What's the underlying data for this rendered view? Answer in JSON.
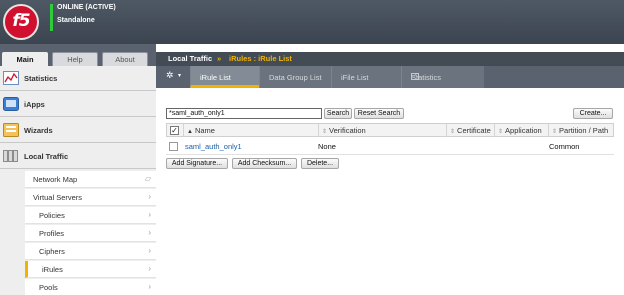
{
  "header": {
    "status_online": "ONLINE (ACTIVE)",
    "status_standalone": "Standalone",
    "logo_text": "f5"
  },
  "sidebar": {
    "tabs": [
      {
        "label": "Main",
        "active": true
      },
      {
        "label": "Help",
        "active": false
      },
      {
        "label": "About",
        "active": false
      }
    ],
    "sections": [
      {
        "label": "Statistics",
        "icon": "statistics-icon"
      },
      {
        "label": "iApps",
        "icon": "iapps-icon"
      },
      {
        "label": "Wizards",
        "icon": "wizards-icon"
      },
      {
        "label": "Local Traffic",
        "icon": "local-traffic-icon"
      }
    ],
    "local_traffic_items": [
      {
        "label": "Network Map",
        "arrow": "▱"
      },
      {
        "label": "Virtual Servers",
        "arrow": "›"
      },
      {
        "label": "Policies",
        "arrow": "›"
      },
      {
        "label": "Profiles",
        "arrow": "›"
      },
      {
        "label": "Ciphers",
        "arrow": "›"
      },
      {
        "label": "iRules",
        "arrow": "›",
        "active": true
      },
      {
        "label": "Pools",
        "arrow": "›"
      }
    ]
  },
  "content": {
    "breadcrumb_section": "Local Traffic",
    "breadcrumb_separator": "»",
    "breadcrumb_page": "iRules : iRule List",
    "subtabs": [
      {
        "label": "iRule List",
        "active": true
      },
      {
        "label": "Data Group List",
        "active": false
      },
      {
        "label": "iFile List",
        "active": false
      },
      {
        "label": "Statistics",
        "active": false
      }
    ],
    "search": {
      "value": "*saml_auth_only1",
      "search_label": "Search",
      "reset_label": "Reset Search",
      "create_label": "Create..."
    },
    "table": {
      "columns": [
        "Name",
        "Verification",
        "Certificate",
        "Application",
        "Partition / Path"
      ],
      "rows": [
        {
          "name": "saml_auth_only1",
          "verification": "None",
          "certificate": "",
          "application": "",
          "partition": "Common"
        }
      ]
    },
    "actions": {
      "add_signature": "Add Signature...",
      "add_checksum": "Add Checksum...",
      "delete": "Delete..."
    }
  },
  "colors": {
    "accent": "#f2b200",
    "header_bg": "#3b444f",
    "status_green": "#2ecb3c",
    "link": "#1a5ea8",
    "logo_red": "#d0102e"
  }
}
